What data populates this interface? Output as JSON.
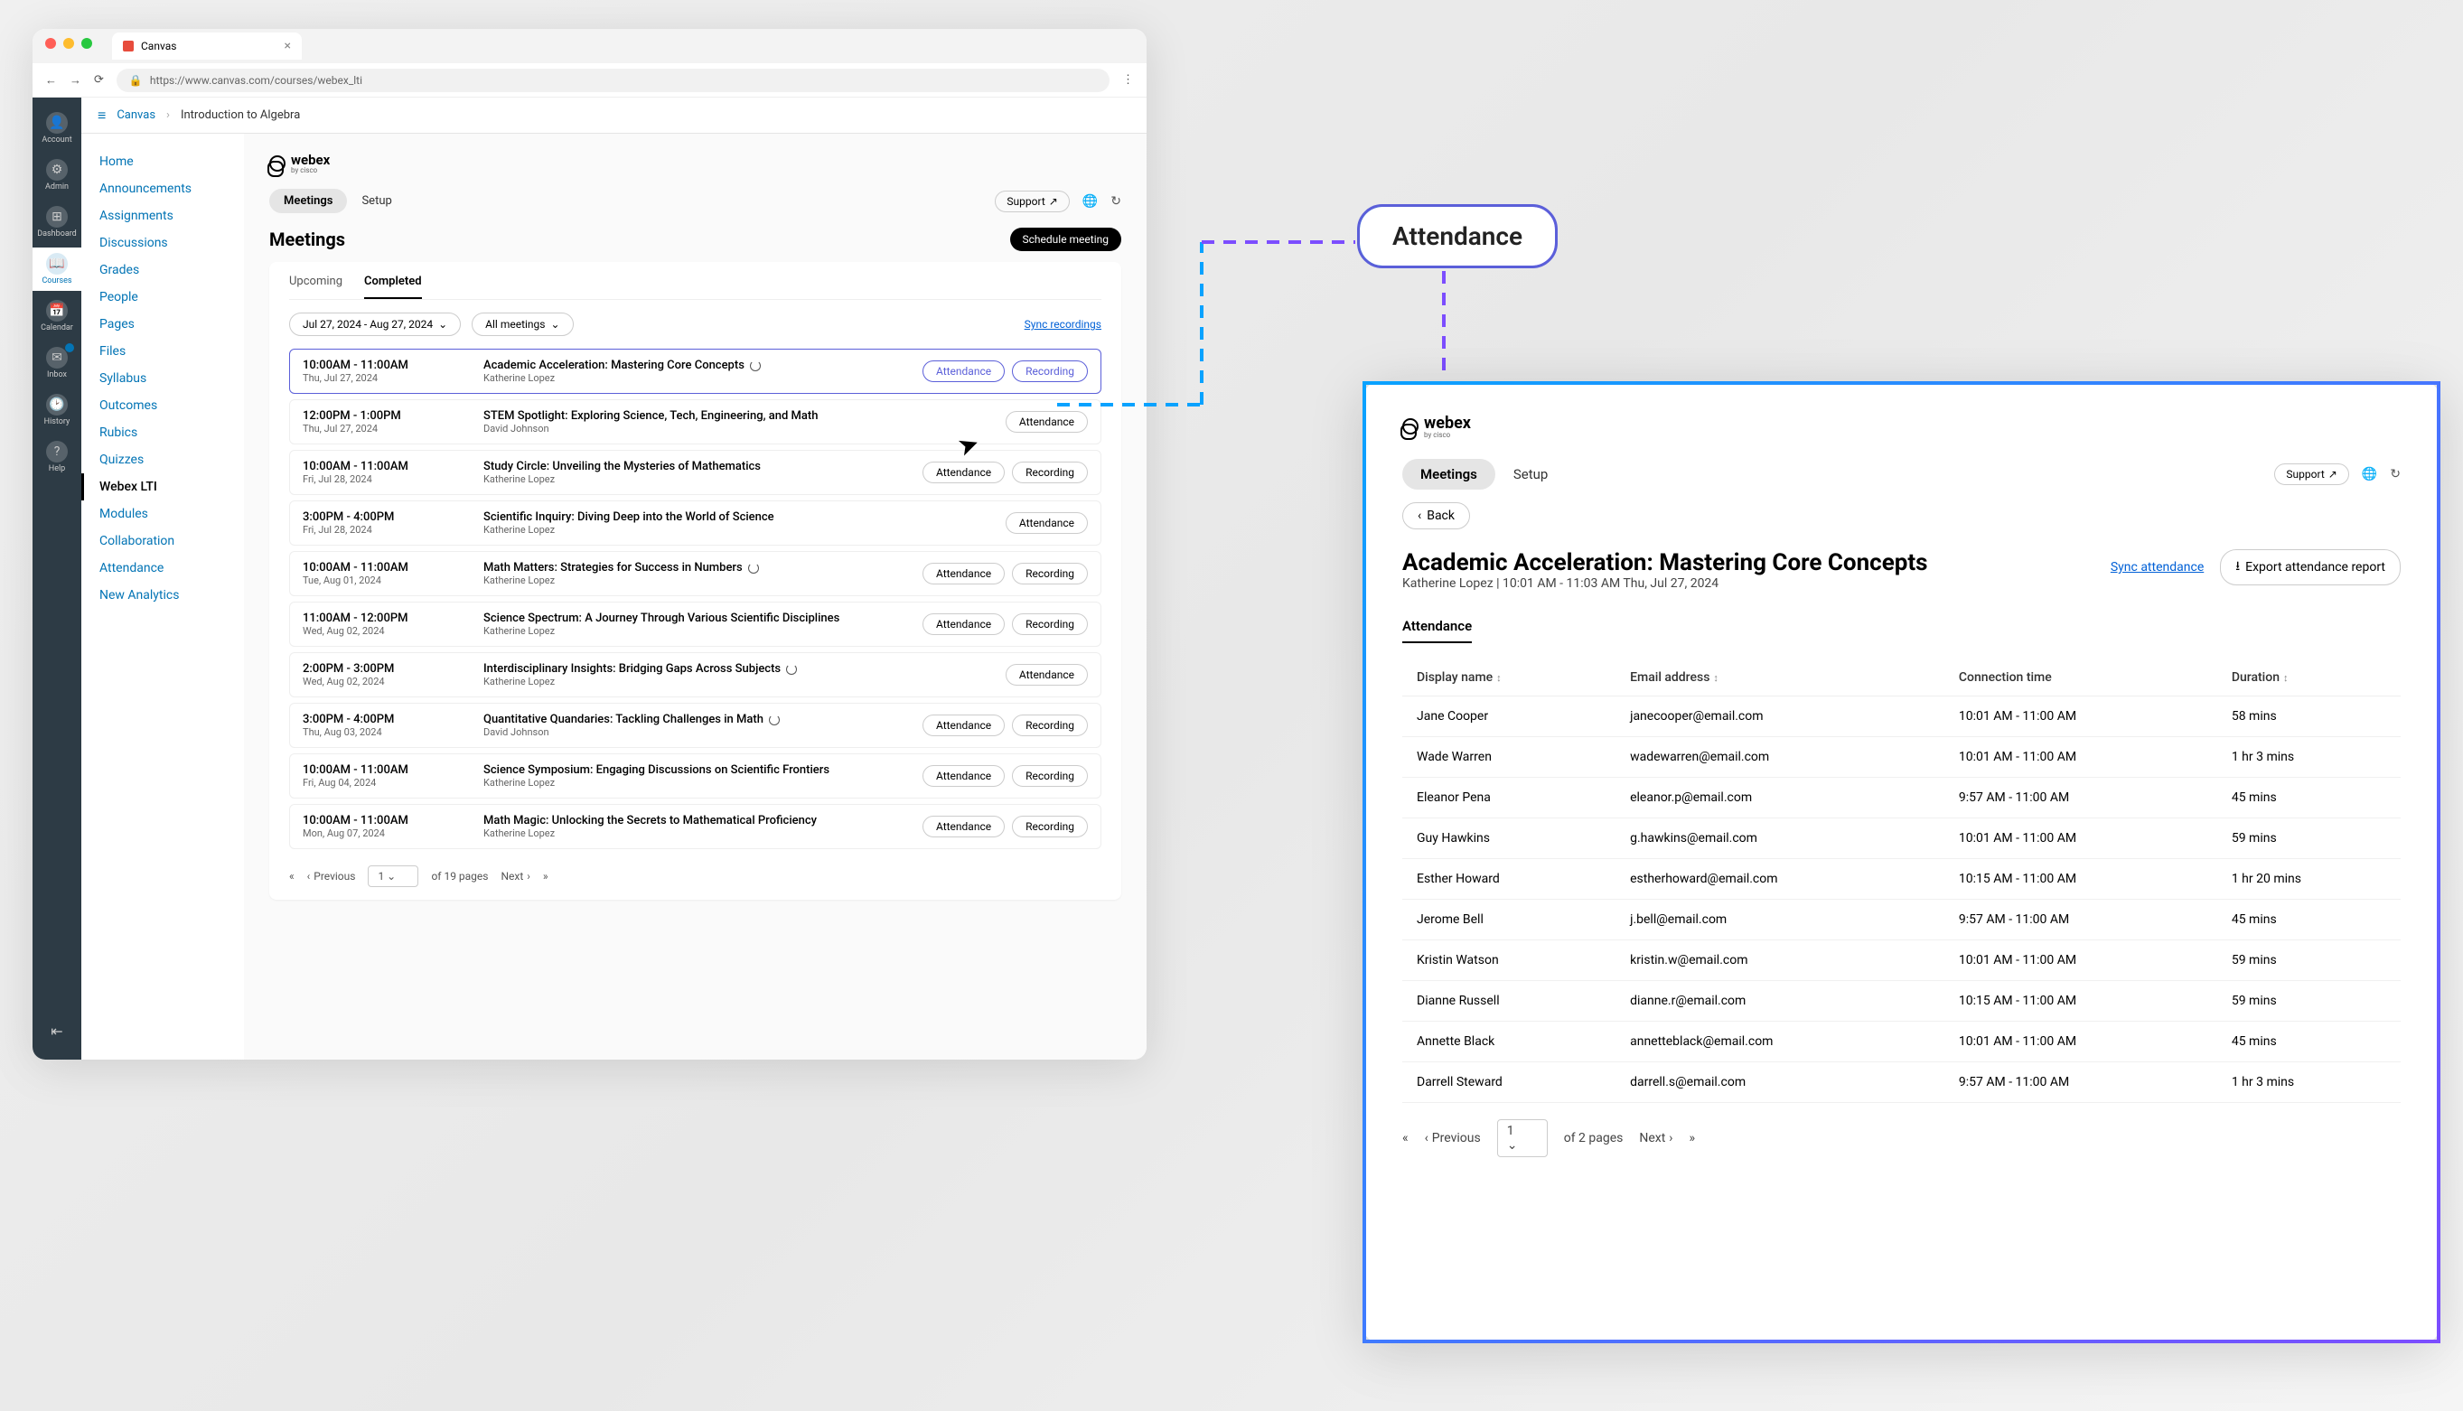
{
  "browser": {
    "tab_title": "Canvas",
    "url": "https://www.canvas.com/courses/webex_lti",
    "nav_back": "←",
    "nav_fwd": "→",
    "nav_reload": "⟳"
  },
  "global_nav": {
    "items": [
      {
        "label": "Account",
        "icon": "👤"
      },
      {
        "label": "Admin",
        "icon": "⚙"
      },
      {
        "label": "Dashboard",
        "icon": "⊞"
      },
      {
        "label": "Courses",
        "icon": "📖",
        "active": true
      },
      {
        "label": "Calendar",
        "icon": "📅"
      },
      {
        "label": "Inbox",
        "icon": "✉"
      },
      {
        "label": "History",
        "icon": "🕑"
      },
      {
        "label": "Help",
        "icon": "?"
      }
    ]
  },
  "breadcrumb": {
    "root": "Canvas",
    "current": "Introduction to Algebra"
  },
  "course_nav": [
    "Home",
    "Announcements",
    "Assignments",
    "Discussions",
    "Grades",
    "People",
    "Pages",
    "Files",
    "Syllabus",
    "Outcomes",
    "Rubics",
    "Quizzes",
    "Webex LTI",
    "Modules",
    "Collaboration",
    "Attendance",
    "New Analytics"
  ],
  "course_nav_active": "Webex LTI",
  "webex": {
    "brand": "webex",
    "brand_sub": "by cisco",
    "tabs": {
      "meetings": "Meetings",
      "setup": "Setup"
    },
    "support": "Support",
    "heading": "Meetings",
    "schedule": "Schedule meeting",
    "sub_tabs": {
      "upcoming": "Upcoming",
      "completed": "Completed"
    },
    "date_filter": "Jul 27, 2024 - Aug 27, 2024",
    "type_filter": "All meetings",
    "sync_recordings": "Sync recordings",
    "attendance_label": "Attendance",
    "recording_label": "Recording",
    "meetings": [
      {
        "time": "10:00AM - 11:00AM",
        "date": "Thu, Jul 27, 2024",
        "title": "Academic Acceleration: Mastering Core Concepts",
        "host": "Katherine Lopez",
        "recurring": true,
        "rec": true,
        "hl": true
      },
      {
        "time": "12:00PM - 1:00PM",
        "date": "Thu, Jul 27, 2024",
        "title": "STEM Spotlight: Exploring Science, Tech, Engineering, and Math",
        "host": "David Johnson",
        "recurring": false,
        "rec": false
      },
      {
        "time": "10:00AM - 11:00AM",
        "date": "Fri, Jul 28, 2024",
        "title": "Study Circle: Unveiling the Mysteries of Mathematics",
        "host": "Katherine Lopez",
        "recurring": false,
        "rec": true
      },
      {
        "time": "3:00PM - 4:00PM",
        "date": "Fri, Jul 28, 2024",
        "title": "Scientific Inquiry: Diving Deep into the World of Science",
        "host": "Katherine Lopez",
        "recurring": false,
        "rec": false
      },
      {
        "time": "10:00AM - 11:00AM",
        "date": "Tue, Aug 01, 2024",
        "title": "Math Matters: Strategies for Success in Numbers",
        "host": "Katherine Lopez",
        "recurring": true,
        "rec": true
      },
      {
        "time": "11:00AM - 12:00PM",
        "date": "Wed, Aug 02, 2024",
        "title": "Science Spectrum: A Journey Through Various Scientific Disciplines",
        "host": "Katherine Lopez",
        "recurring": false,
        "rec": true
      },
      {
        "time": "2:00PM - 3:00PM",
        "date": "Wed, Aug 02, 2024",
        "title": "Interdisciplinary Insights: Bridging Gaps Across Subjects",
        "host": "Katherine Lopez",
        "recurring": true,
        "rec": false
      },
      {
        "time": "3:00PM - 4:00PM",
        "date": "Thu, Aug 03, 2024",
        "title": "Quantitative Quandaries: Tackling Challenges in Math",
        "host": "David Johnson",
        "recurring": true,
        "rec": true
      },
      {
        "time": "10:00AM - 11:00AM",
        "date": "Fri, Aug 04, 2024",
        "title": "Science Symposium: Engaging Discussions on Scientific Frontiers",
        "host": "Katherine Lopez",
        "recurring": false,
        "rec": true
      },
      {
        "time": "10:00AM - 11:00AM",
        "date": "Mon, Aug 07, 2024",
        "title": "Math Magic: Unlocking the Secrets to Mathematical Proficiency",
        "host": "Katherine Lopez",
        "recurring": false,
        "rec": true
      }
    ],
    "pagination": {
      "prev": "Previous",
      "next": "Next",
      "page": "1",
      "of": "of 19 pages"
    }
  },
  "callout": "Attendance",
  "detail": {
    "back": "Back",
    "title": "Academic Acceleration: Mastering Core Concepts",
    "subline": "Katherine Lopez | 10:01 AM - 11:03 AM Thu, Jul 27, 2024",
    "sync": "Sync attendance",
    "export": "Export attendance report",
    "tab": "Attendance",
    "cols": {
      "name": "Display name",
      "email": "Email address",
      "conn": "Connection time",
      "dur": "Duration"
    },
    "rows": [
      {
        "name": "Jane Cooper",
        "email": "janecooper@email.com",
        "conn": "10:01 AM - 11:00 AM",
        "dur": "58 mins"
      },
      {
        "name": "Wade Warren",
        "email": "wadewarren@email.com",
        "conn": "10:01 AM - 11:00 AM",
        "dur": "1 hr 3 mins"
      },
      {
        "name": "Eleanor Pena",
        "email": "eleanor.p@email.com",
        "conn": "9:57 AM - 11:00 AM",
        "dur": "45 mins"
      },
      {
        "name": "Guy Hawkins",
        "email": "g.hawkins@email.com",
        "conn": "10:01 AM - 11:00 AM",
        "dur": "59 mins"
      },
      {
        "name": "Esther Howard",
        "email": "estherhoward@email.com",
        "conn": "10:15 AM - 11:00 AM",
        "dur": "1 hr 20 mins"
      },
      {
        "name": "Jerome Bell",
        "email": "j.bell@email.com",
        "conn": "9:57 AM - 11:00 AM",
        "dur": "45 mins"
      },
      {
        "name": "Kristin Watson",
        "email": "kristin.w@email.com",
        "conn": "10:01 AM - 11:00 AM",
        "dur": "59 mins"
      },
      {
        "name": "Dianne Russell",
        "email": "dianne.r@email.com",
        "conn": "10:15 AM - 11:00 AM",
        "dur": "59 mins"
      },
      {
        "name": "Annette Black",
        "email": "annetteblack@email.com",
        "conn": "10:01 AM - 11:00 AM",
        "dur": "45 mins"
      },
      {
        "name": "Darrell Steward",
        "email": "darrell.s@email.com",
        "conn": "9:57 AM - 11:00 AM",
        "dur": "1 hr 3 mins"
      }
    ],
    "pagination": {
      "prev": "Previous",
      "next": "Next",
      "page": "1",
      "of": "of 2 pages"
    }
  }
}
